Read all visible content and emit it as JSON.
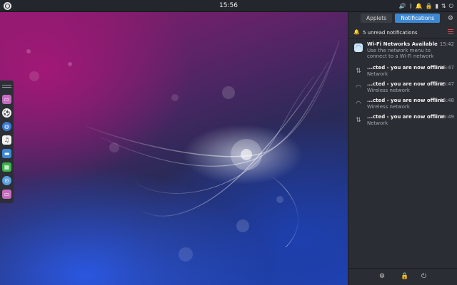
{
  "topbar": {
    "clock": "15:56",
    "tray_icons": [
      "volume-icon",
      "bluetooth-icon",
      "notification-bell-icon",
      "lock-icon",
      "battery-icon",
      "network-icon",
      "power-icon"
    ]
  },
  "dock": {
    "items": [
      {
        "name": "files-app",
        "color": "#c56bc0"
      },
      {
        "name": "soccer-app",
        "color": "#f2f2f2"
      },
      {
        "name": "browser-app",
        "color": "#3b7bd6"
      },
      {
        "name": "music-app",
        "color": "#f2f2f2"
      },
      {
        "name": "folder-app",
        "color": "#3d88d4"
      },
      {
        "name": "spreadsheet-app",
        "color": "#3bb14a"
      },
      {
        "name": "network-app",
        "color": "#5aa0e0"
      },
      {
        "name": "files-app-2",
        "color": "#c56bc0"
      }
    ]
  },
  "sidebar": {
    "tabs": [
      {
        "label": "Applets",
        "active": false
      },
      {
        "label": "Notifications",
        "active": true
      }
    ],
    "notif_header": "5 unread notifications",
    "notifications": [
      {
        "icon": "wifi-icon",
        "title": "Wi-Fi Networks Available",
        "body": "Use the network menu to\nconnect to a Wi-Fi network",
        "time": "15:42"
      },
      {
        "icon": "network-offline-icon",
        "title": "...cted - you are now offline",
        "body": "Network",
        "time": "15:47"
      },
      {
        "icon": "wifi-offline-icon",
        "title": "...cted - you are now offline",
        "body": "Wireless network",
        "time": "15:47"
      },
      {
        "icon": "wifi-offline-icon",
        "title": "...cted - you are now offline",
        "body": "Wireless network",
        "time": "15:48"
      },
      {
        "icon": "network-offline-icon",
        "title": "...cted - you are now offline",
        "body": "Network",
        "time": "15:49"
      }
    ],
    "footer": [
      "settings-icon",
      "lock-icon",
      "power-icon"
    ]
  },
  "colors": {
    "accent": "#3d88d4",
    "panel": "#2a2d33",
    "topbar": "#23262d"
  }
}
